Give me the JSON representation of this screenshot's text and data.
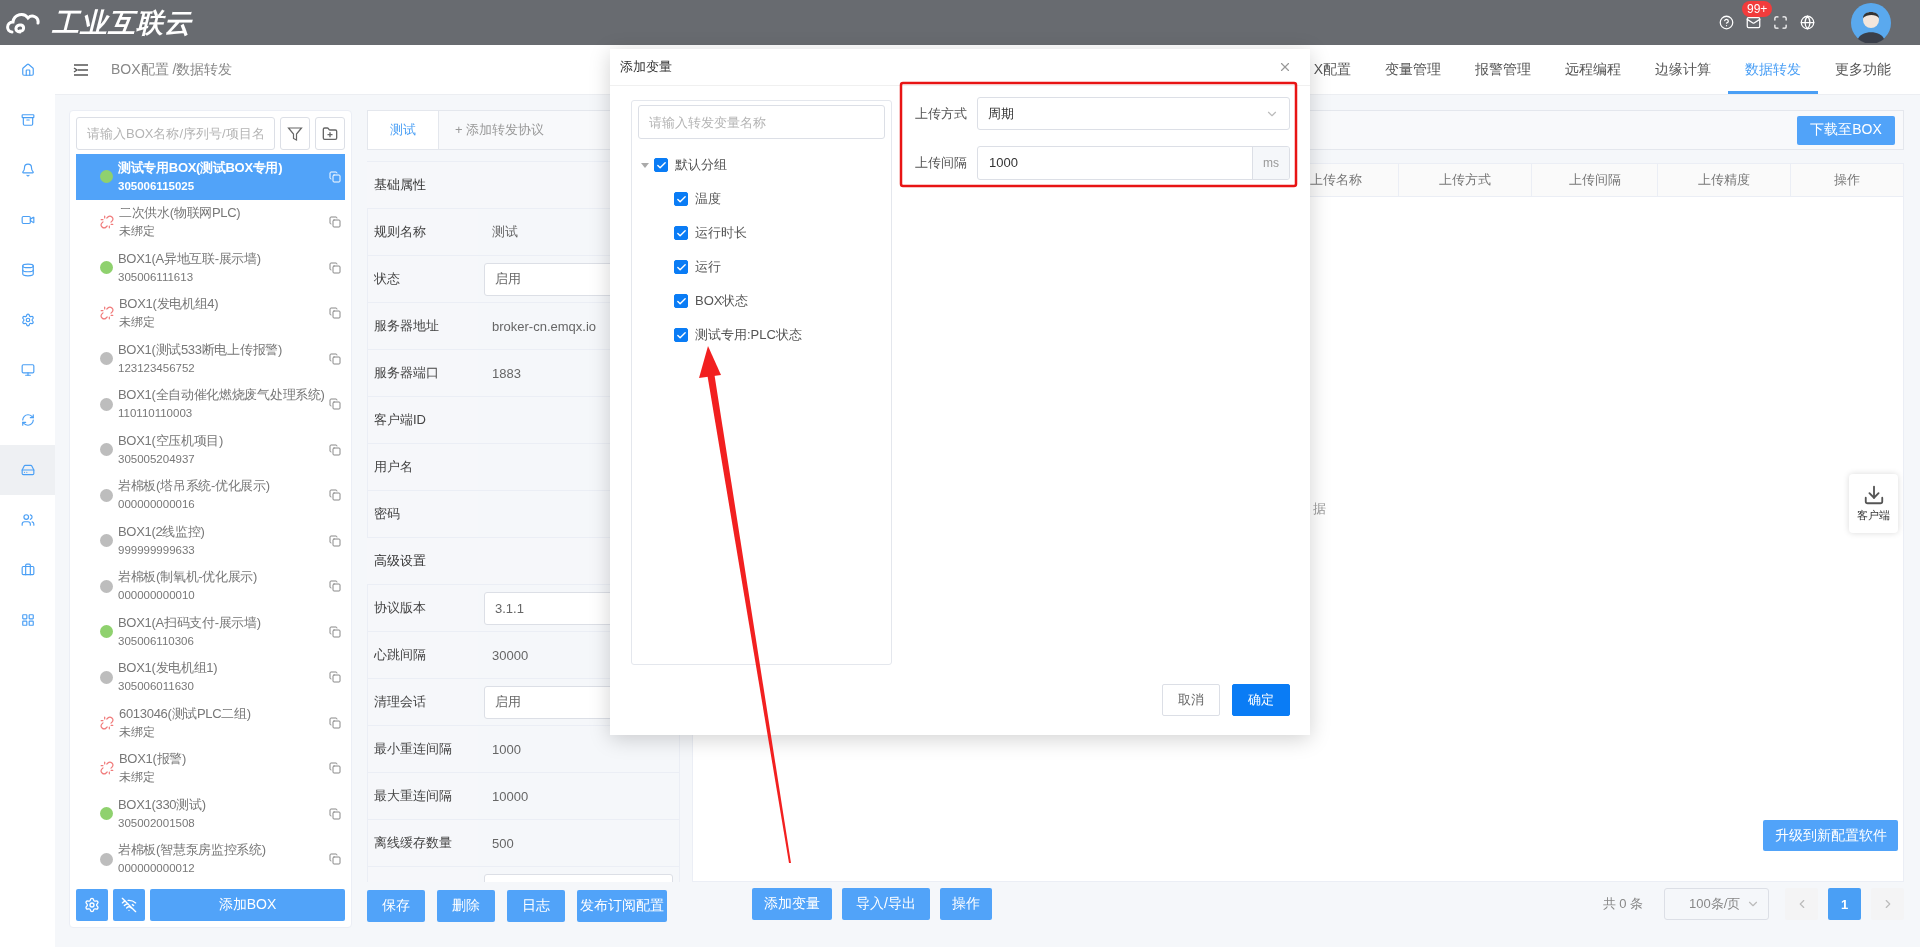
{
  "top_bar": {
    "logo_text": "工业互联云",
    "badge": "99+"
  },
  "rail": [
    {
      "selected": false
    },
    {
      "selected": false
    },
    {
      "selected": false
    },
    {
      "selected": false
    },
    {
      "selected": false
    },
    {
      "selected": false
    },
    {
      "selected": false
    },
    {
      "selected": false
    },
    {
      "selected": true
    },
    {
      "selected": false
    },
    {
      "selected": false
    },
    {
      "selected": false
    }
  ],
  "header": {
    "breadcrumb": "BOX配置 /数据转发",
    "tabs": [
      {
        "label": "X配置",
        "selected": false
      },
      {
        "label": "变量管理",
        "selected": false
      },
      {
        "label": "报警管理",
        "selected": false
      },
      {
        "label": "远程编程",
        "selected": false
      },
      {
        "label": "边缘计算",
        "selected": false
      },
      {
        "label": "数据转发",
        "selected": true
      },
      {
        "label": "更多功能",
        "selected": false
      }
    ]
  },
  "box_list": {
    "search_placeholder": "请输入BOX名称/序列号/项目名",
    "items": [
      {
        "name": "测试专用BOX(测试BOX专用)",
        "serial": "305006115025",
        "bound": true,
        "color": "#8fd16e",
        "selected": true
      },
      {
        "name": "二次供水(物联网PLC)",
        "serial": "未绑定",
        "bound": false,
        "selected": false
      },
      {
        "name": "BOX1(A异地互联-展示墙)",
        "serial": "305006111613",
        "bound": true,
        "color": "#8fd16e",
        "selected": false
      },
      {
        "name": "BOX1(发电机组4)",
        "serial": "未绑定",
        "bound": false,
        "selected": false
      },
      {
        "name": "BOX1(测试533断电上传报警)",
        "serial": "123123456752",
        "bound": true,
        "color": "#bdbdbd",
        "selected": false
      },
      {
        "name": "BOX1(全自动催化燃烧废气处理系统)",
        "serial": "110110110003",
        "bound": true,
        "color": "#bdbdbd",
        "selected": false
      },
      {
        "name": "BOX1(空压机项目)",
        "serial": "305005204937",
        "bound": true,
        "color": "#bdbdbd",
        "selected": false
      },
      {
        "name": "岩棉板(塔吊系统-优化展示)",
        "serial": "000000000016",
        "bound": true,
        "color": "#bdbdbd",
        "selected": false
      },
      {
        "name": "BOX1(2线监控)",
        "serial": "999999999633",
        "bound": true,
        "color": "#bdbdbd",
        "selected": false
      },
      {
        "name": "岩棉板(制氧机-优化展示)",
        "serial": "000000000010",
        "bound": true,
        "color": "#bdbdbd",
        "selected": false
      },
      {
        "name": "BOX1(A扫码支付-展示墙)",
        "serial": "305006110306",
        "bound": true,
        "color": "#8fd16e",
        "selected": false
      },
      {
        "name": "BOX1(发电机组1)",
        "serial": "305006011630",
        "bound": true,
        "color": "#bdbdbd",
        "selected": false
      },
      {
        "name": "6013046(测试PLC二组)",
        "serial": "未绑定",
        "bound": false,
        "selected": false
      },
      {
        "name": "BOX1(报警)",
        "serial": "未绑定",
        "bound": false,
        "selected": false
      },
      {
        "name": "BOX1(330测试)",
        "serial": "305002001508",
        "bound": true,
        "color": "#8fd16e",
        "selected": false
      },
      {
        "name": "岩棉板(智慧泵房监控系统)",
        "serial": "000000000012",
        "bound": true,
        "color": "#bdbdbd",
        "selected": false
      }
    ],
    "add_button": "添加BOX"
  },
  "rule": {
    "tabs": [
      {
        "label": "测试",
        "selected": true
      },
      {
        "label": "+ 添加转发协议",
        "selected": false
      }
    ],
    "rows": [
      {
        "kind": "section",
        "label": "基础属性"
      },
      {
        "kind": "text",
        "label": "规则名称",
        "value": "测试"
      },
      {
        "kind": "select",
        "label": "状态",
        "value": "启用"
      },
      {
        "kind": "text",
        "label": "服务器地址",
        "value": "broker-cn.emqx.io"
      },
      {
        "kind": "text",
        "label": "服务器端口",
        "value": "1883"
      },
      {
        "kind": "text",
        "label": "客户端ID"
      },
      {
        "kind": "text",
        "label": "用户名"
      },
      {
        "kind": "text",
        "label": "密码"
      },
      {
        "kind": "section",
        "label": "高级设置"
      },
      {
        "kind": "select",
        "label": "协议版本",
        "value": "3.1.1"
      },
      {
        "kind": "text",
        "label": "心跳间隔",
        "value": "30000"
      },
      {
        "kind": "select",
        "label": "清理会话",
        "value": "启用"
      },
      {
        "kind": "text",
        "label": "最小重连间隔",
        "value": "1000"
      },
      {
        "kind": "text",
        "label": "最大重连间隔",
        "value": "10000"
      },
      {
        "kind": "text",
        "label": "离线缓存数量",
        "value": "500"
      },
      {
        "kind": "select"
      }
    ],
    "buttons": [
      "保存",
      "删除",
      "日志",
      "发布订阅配置"
    ]
  },
  "forwarding": {
    "download_button": "下载至BOX",
    "columns": [
      "上传名称",
      "上传方式",
      "上传间隔",
      "上传精度",
      "操作"
    ],
    "empty_text": "据",
    "upgrade_button": "升级到新配置软件",
    "buttons": [
      "添加变量",
      "导入/导出",
      "操作"
    ],
    "total": "共 0 条",
    "page_size": "100条/页",
    "pages": [
      {
        "label": "1",
        "selected": true
      }
    ]
  },
  "client_widget": {
    "label": "客户端"
  },
  "dialog": {
    "title": "添加变量",
    "search_placeholder": "请输入转发变量名称",
    "tree": [
      {
        "label": "默认分组",
        "checked": true,
        "expanded": true,
        "children": [
          {
            "label": "温度",
            "checked": true
          },
          {
            "label": "运行时长",
            "checked": true
          },
          {
            "label": "运行",
            "checked": true
          },
          {
            "label": "BOX状态",
            "checked": true
          },
          {
            "label": "测试专用:PLC状态",
            "checked": true
          }
        ]
      }
    ],
    "fields": [
      {
        "kind": "select",
        "label": "上传方式",
        "value": "周期"
      },
      {
        "kind": "input",
        "label": "上传间隔",
        "value": "1000",
        "unit": "ms"
      }
    ],
    "buttons": [
      {
        "label": "取消",
        "kind": "default"
      },
      {
        "label": "确定",
        "kind": "primary"
      }
    ]
  }
}
